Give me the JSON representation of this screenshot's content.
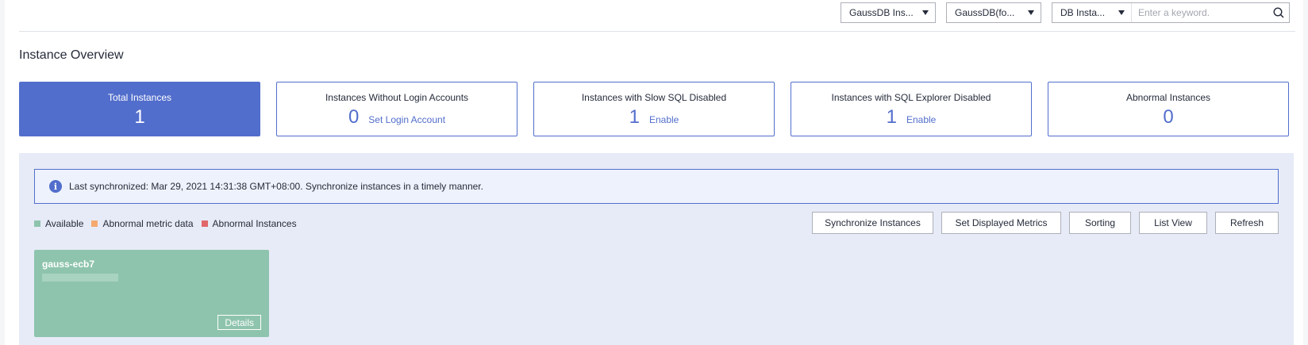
{
  "filters": {
    "engine": "GaussDB Ins...",
    "version": "GaussDB(fo...",
    "search_field": "DB Insta...",
    "search_placeholder": "Enter a keyword."
  },
  "title": "Instance Overview",
  "cards": [
    {
      "label": "Total Instances",
      "value": "1",
      "action": ""
    },
    {
      "label": "Instances Without Login Accounts",
      "value": "0",
      "action": "Set Login Account"
    },
    {
      "label": "Instances with Slow SQL Disabled",
      "value": "1",
      "action": "Enable"
    },
    {
      "label": "Instances with SQL Explorer Disabled",
      "value": "1",
      "action": "Enable"
    },
    {
      "label": "Abnormal Instances",
      "value": "0",
      "action": ""
    }
  ],
  "notice": "Last synchronized: Mar 29, 2021 14:31:38 GMT+08:00. Synchronize instances in a timely manner.",
  "legend": [
    {
      "label": "Available",
      "color": "#8ec4ad"
    },
    {
      "label": "Abnormal metric data",
      "color": "#f5a96f"
    },
    {
      "label": "Abnormal Instances",
      "color": "#e0676b"
    }
  ],
  "actions": {
    "synchronize": "Synchronize Instances",
    "set_metrics": "Set Displayed Metrics",
    "sorting": "Sorting",
    "list_view": "List View",
    "refresh": "Refresh"
  },
  "instance": {
    "name": "gauss-ecb7",
    "details": "Details"
  },
  "colors": {
    "accent": "#526ecc",
    "panel_bg": "#e7ebf7",
    "available": "#8ec4ad"
  }
}
